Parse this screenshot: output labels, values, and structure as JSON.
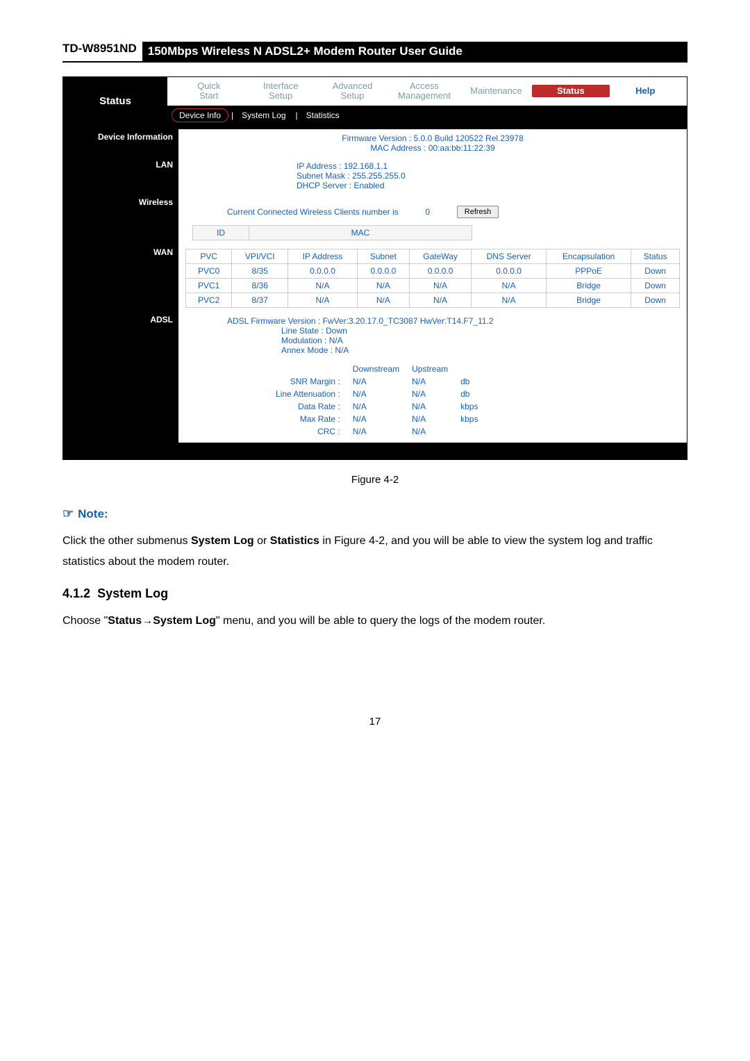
{
  "header": {
    "model": "TD-W8951ND",
    "title": "150Mbps Wireless N ADSL2+ Modem Router User Guide"
  },
  "nav": {
    "status_label": "Status",
    "items": {
      "quick_start": "Quick\nStart",
      "interface_setup": "Interface\nSetup",
      "advanced_setup": "Advanced\nSetup",
      "access_mgmt": "Access\nManagement",
      "maintenance": "Maintenance",
      "status": "Status",
      "help": "Help"
    },
    "sub": {
      "device_info": "Device Info",
      "system_log": "System Log",
      "statistics": "Statistics"
    }
  },
  "device_info": {
    "label": "Device Information",
    "firmware_label": "Firmware Version :",
    "firmware_value": "5.0.0 Build 120522 Rel.23978",
    "mac_label": "MAC Address :",
    "mac_value": "00:aa:bb:11:22:39"
  },
  "lan": {
    "label": "LAN",
    "ip_label": "IP Address :",
    "ip_value": "192.168.1.1",
    "subnet_label": "Subnet Mask :",
    "subnet_value": "255.255.255.0",
    "dhcp_label": "DHCP Server :",
    "dhcp_value": "Enabled"
  },
  "wireless": {
    "label": "Wireless",
    "clients_text": "Current Connected Wireless Clients number is",
    "clients_count": "0",
    "refresh": "Refresh",
    "col_id": "ID",
    "col_mac": "MAC"
  },
  "wan": {
    "label": "WAN",
    "cols": {
      "pvc": "PVC",
      "vpivci": "VPI/VCI",
      "ip": "IP Address",
      "subnet": "Subnet",
      "gateway": "GateWay",
      "dns": "DNS Server",
      "encap": "Encapsulation",
      "status": "Status"
    },
    "rows": [
      {
        "pvc": "PVC0",
        "vpivci": "8/35",
        "ip": "0.0.0.0",
        "subnet": "0.0.0.0",
        "gateway": "0.0.0.0",
        "dns": "0.0.0.0",
        "encap": "PPPoE",
        "status": "Down"
      },
      {
        "pvc": "PVC1",
        "vpivci": "8/36",
        "ip": "N/A",
        "subnet": "N/A",
        "gateway": "N/A",
        "dns": "N/A",
        "encap": "Bridge",
        "status": "Down"
      },
      {
        "pvc": "PVC2",
        "vpivci": "8/37",
        "ip": "N/A",
        "subnet": "N/A",
        "gateway": "N/A",
        "dns": "N/A",
        "encap": "Bridge",
        "status": "Down"
      }
    ]
  },
  "adsl": {
    "label": "ADSL",
    "fw_label": "ADSL Firmware Version :",
    "fw_value": "FwVer:3.20.17.0_TC3087 HwVer:T14.F7_11.2",
    "line_state_label": "Line State :",
    "line_state_value": "Down",
    "modulation_label": "Modulation :",
    "modulation_value": "N/A",
    "annex_label": "Annex Mode :",
    "annex_value": "N/A",
    "col_down": "Downstream",
    "col_up": "Upstream",
    "rows": [
      {
        "name": "SNR Margin :",
        "d": "N/A",
        "u": "N/A",
        "unit": "db"
      },
      {
        "name": "Line Attenuation :",
        "d": "N/A",
        "u": "N/A",
        "unit": "db"
      },
      {
        "name": "Data Rate :",
        "d": "N/A",
        "u": "N/A",
        "unit": "kbps"
      },
      {
        "name": "Max Rate :",
        "d": "N/A",
        "u": "N/A",
        "unit": "kbps"
      },
      {
        "name": "CRC :",
        "d": "N/A",
        "u": "N/A",
        "unit": ""
      }
    ]
  },
  "caption": "Figure 4-2",
  "note": {
    "label": "Note:",
    "text_pre": "Click the other submenus ",
    "b1": "System Log",
    "mid": " or ",
    "b2": "Statistics",
    "text_post": " in Figure 4-2, and you will be able to view the system log and traffic statistics about the modem router."
  },
  "section": {
    "num": "4.1.2",
    "title": "System Log",
    "body_pre": "Choose \"",
    "b1": "Status",
    "arrow": "→",
    "b2": "System Log",
    "body_post": "\" menu, and you will be able to query the logs of the modem router."
  },
  "page_num": "17"
}
